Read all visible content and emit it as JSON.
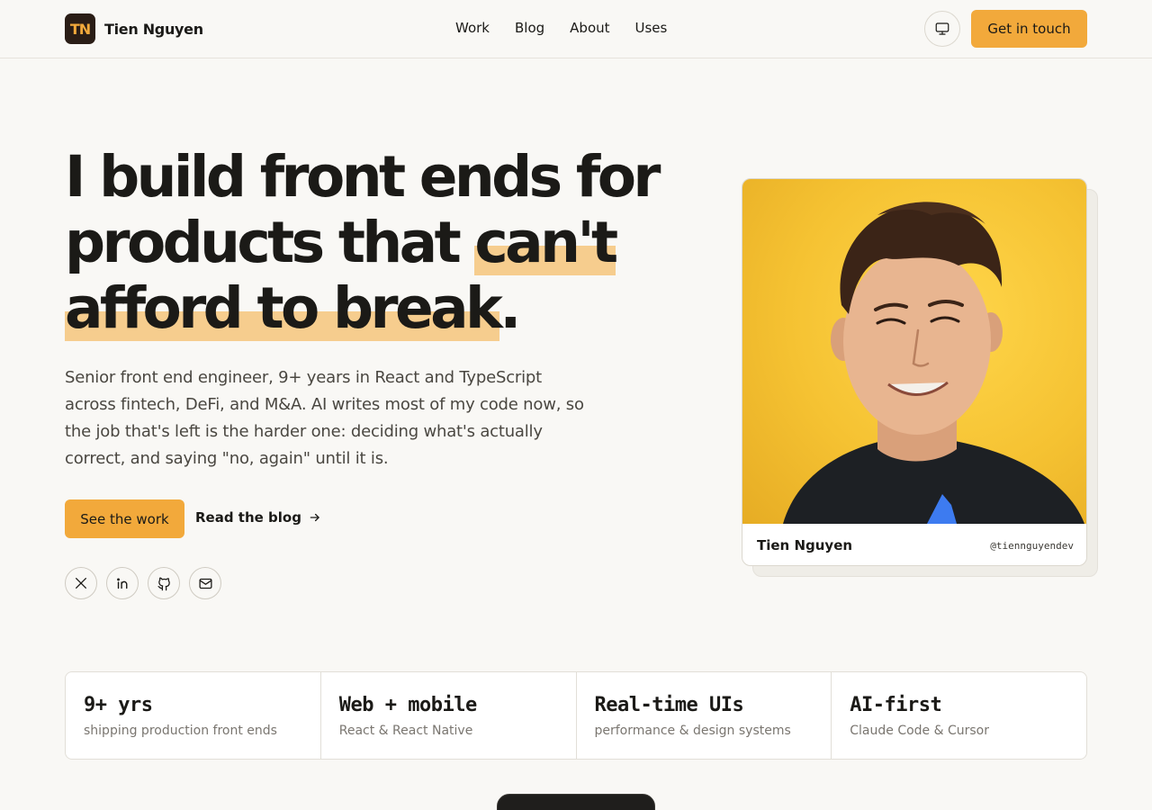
{
  "header": {
    "logo_text": "TN",
    "brand_name": "Tien Nguyen",
    "nav": [
      "Work",
      "Blog",
      "About",
      "Uses"
    ],
    "theme_icon": "monitor-icon",
    "cta_label": "Get in touch"
  },
  "hero": {
    "title_part1": "I build front ends for products that ",
    "title_highlight1": "can't",
    "title_highlight2": "afford to break",
    "title_end": ".",
    "description": "Senior front end engineer, 9+ years in React and TypeScript across fintech, DeFi, and M&A. AI writes most of my code now, so the job that's left is the harder one: deciding what's actually correct, and saying \"no, again\" until it is.",
    "primary_button": "See the work",
    "secondary_link": "Read the blog",
    "socials": [
      "x-icon",
      "linkedin-icon",
      "github-icon",
      "mail-icon"
    ]
  },
  "card": {
    "name": "Tien Nguyen",
    "handle": "@tiennguyendev",
    "accent": "#f5c232"
  },
  "stats": [
    {
      "value": "9+ yrs",
      "label": "shipping production front ends"
    },
    {
      "value": "Web + mobile",
      "label": "React & React Native"
    },
    {
      "value": "Real-time UIs",
      "label": "performance & design systems"
    },
    {
      "value": "AI-first",
      "label": "Claude Code & Cursor"
    }
  ],
  "colors": {
    "accent": "#f2a93b",
    "highlight": "#f6cd8e",
    "background": "#f9f8f5"
  }
}
